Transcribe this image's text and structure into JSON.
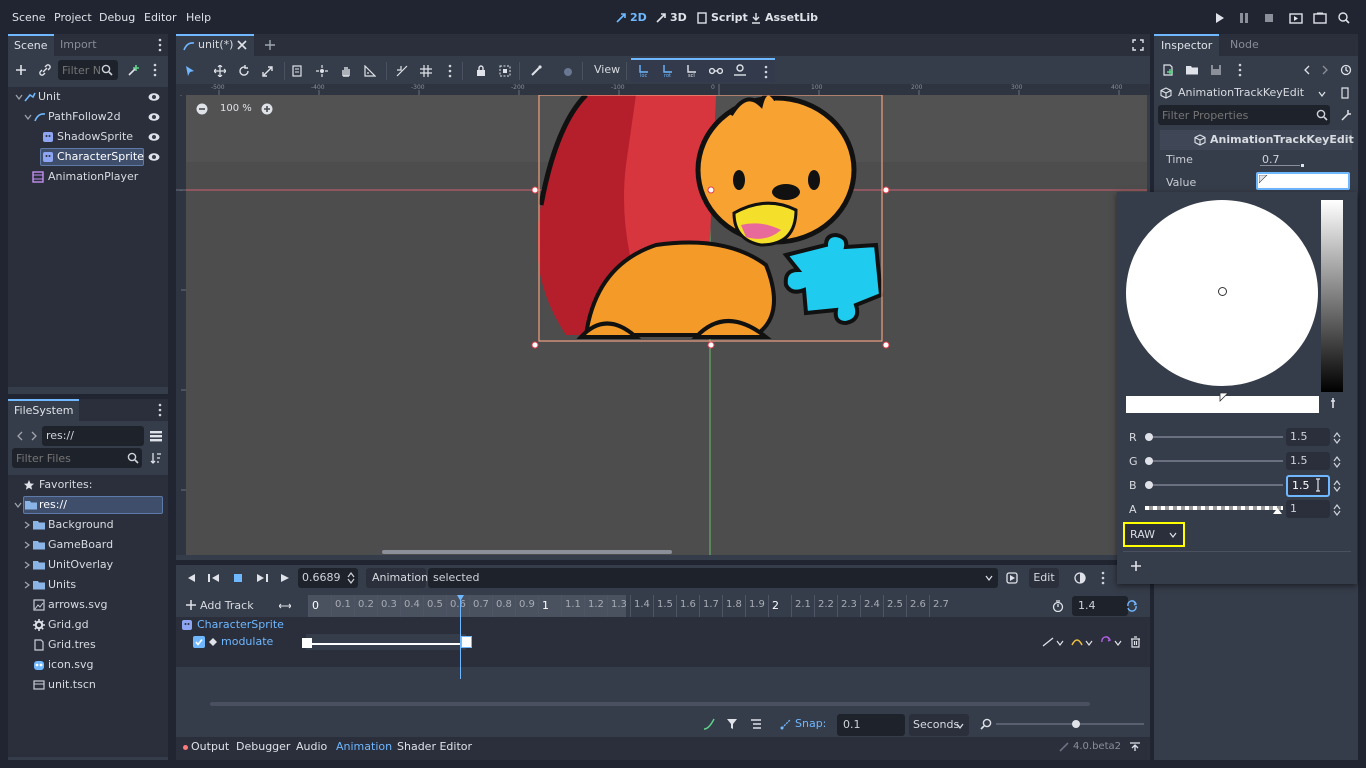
{
  "menu": [
    "Scene",
    "Project",
    "Debug",
    "Editor",
    "Help"
  ],
  "workspaces": [
    {
      "label": "2D",
      "active": true
    },
    {
      "label": "3D",
      "active": false
    },
    {
      "label": "Script",
      "active": false
    },
    {
      "label": "AssetLib",
      "active": false
    }
  ],
  "scene_dock": {
    "tabs": [
      "Scene",
      "Import"
    ],
    "filter_placeholder": "Filter N",
    "tree": [
      {
        "label": "Unit",
        "icon": "node2d-icon",
        "level": 0,
        "eye": true
      },
      {
        "label": "PathFollow2d",
        "icon": "path-icon",
        "level": 1,
        "eye": true
      },
      {
        "label": "ShadowSprite",
        "icon": "sprite-icon",
        "level": 2,
        "eye": true
      },
      {
        "label": "CharacterSprite",
        "icon": "sprite-icon",
        "level": 2,
        "eye": true,
        "selected": true
      },
      {
        "label": "AnimationPlayer",
        "icon": "animationplayer-icon",
        "level": 1,
        "eye": false
      }
    ]
  },
  "filesystem": {
    "title": "FileSystem",
    "path": "res://",
    "filter_placeholder": "Filter Files",
    "favorites": "Favorites:",
    "items": [
      {
        "label": "res://",
        "type": "folder",
        "level": 0,
        "selected": true
      },
      {
        "label": "Background",
        "type": "folder",
        "level": 1
      },
      {
        "label": "GameBoard",
        "type": "folder",
        "level": 1
      },
      {
        "label": "UnitOverlay",
        "type": "folder",
        "level": 1
      },
      {
        "label": "Units",
        "type": "folder",
        "level": 1
      },
      {
        "label": "arrows.svg",
        "type": "image",
        "level": 1
      },
      {
        "label": "Grid.gd",
        "type": "script",
        "level": 1
      },
      {
        "label": "Grid.tres",
        "type": "resource",
        "level": 1
      },
      {
        "label": "icon.svg",
        "type": "image",
        "level": 1
      },
      {
        "label": "unit.tscn",
        "type": "scene",
        "level": 1
      }
    ]
  },
  "editor": {
    "scene_tab": "unit(*)",
    "view_label": "View",
    "zoom": "100 %",
    "ruler_labels": [
      "-500",
      "-400",
      "-300",
      "-200",
      "-100",
      "0",
      "100",
      "200",
      "300",
      "400"
    ]
  },
  "animation": {
    "time": "0.6689",
    "anim_label": "Animation",
    "anim_name": "selected",
    "edit": "Edit",
    "add_track": "Add Track",
    "length": "1.4",
    "timeline_ticks": [
      "0",
      "0.1",
      "0.2",
      "0.3",
      "0.4",
      "0.5",
      "0.6",
      "0.7",
      "0.8",
      "0.9",
      "1",
      "1.1",
      "1.2",
      "1.3",
      "1.4",
      "1.5",
      "1.6",
      "1.7",
      "1.8",
      "1.9",
      "2",
      "2.1",
      "2.2",
      "2.3",
      "2.4",
      "2.5",
      "2.6",
      "2.7"
    ],
    "track_node": "CharacterSprite",
    "track_prop": "modulate",
    "snap_label": "Snap:",
    "snap_value": "0.1",
    "snap_unit": "Seconds"
  },
  "bottom_tabs": [
    {
      "label": "Output",
      "active": false,
      "dot": true
    },
    {
      "label": "Debugger",
      "active": false
    },
    {
      "label": "Audio",
      "active": false
    },
    {
      "label": "Animation",
      "active": true
    },
    {
      "label": "Shader Editor",
      "active": false
    }
  ],
  "version": "4.0.beta2",
  "inspector": {
    "tabs": [
      "Inspector",
      "Node"
    ],
    "object": "AnimationTrackKeyEdit",
    "filter_placeholder": "Filter Properties",
    "section": "AnimationTrackKeyEdit",
    "time_label": "Time",
    "time_value": "0.7",
    "value_label": "Value"
  },
  "color_picker": {
    "channels": [
      {
        "label": "R",
        "value": "1.5"
      },
      {
        "label": "G",
        "value": "1.5"
      },
      {
        "label": "B",
        "value": "1.5"
      },
      {
        "label": "A",
        "value": "1"
      }
    ],
    "mode": "RAW"
  },
  "colors": {
    "accent": "#6fb7ff",
    "bg": "#202531",
    "panel": "#363d4a",
    "highlight": "#ffff00"
  }
}
